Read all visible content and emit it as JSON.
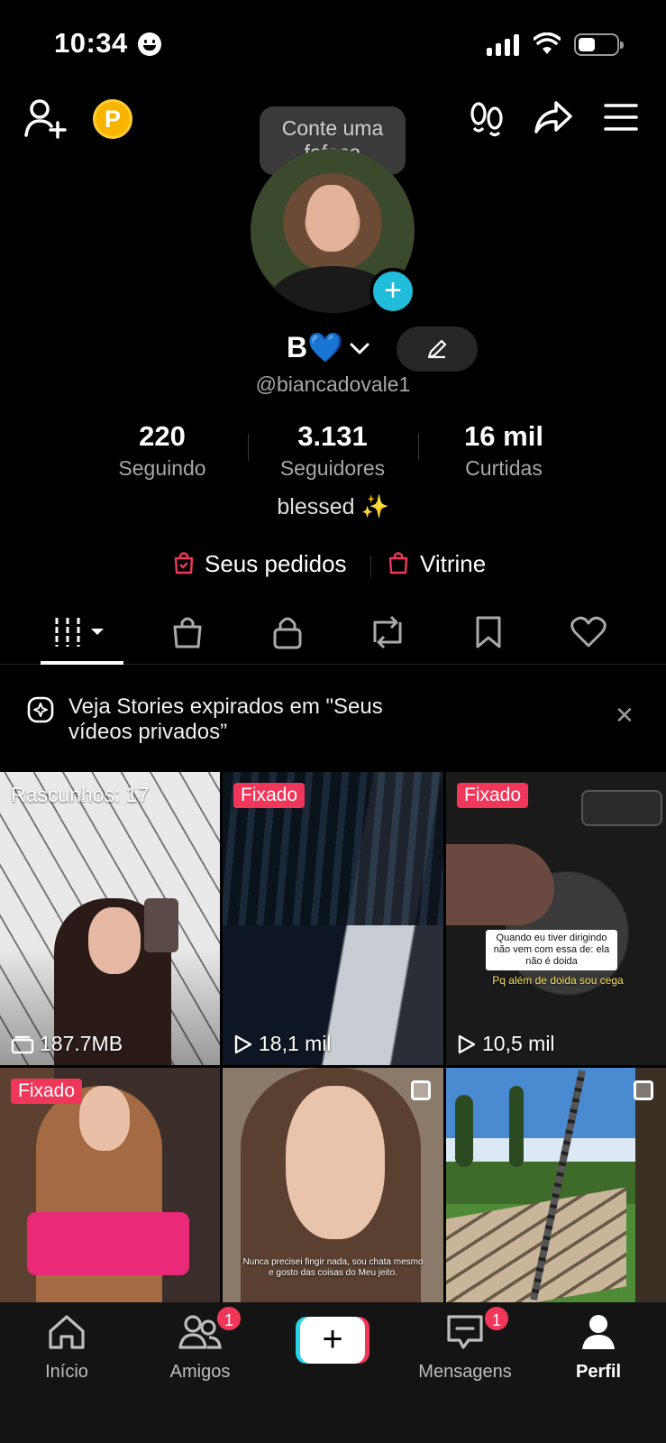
{
  "status_bar": {
    "time": "10:34"
  },
  "tooltip": {
    "text": "Conte uma fofoca"
  },
  "profile": {
    "display_name": "B💙",
    "handle": "@biancadovale1",
    "bio": "blessed ✨"
  },
  "stats": [
    {
      "value": "220",
      "label": "Seguindo"
    },
    {
      "value": "3.131",
      "label": "Seguidores"
    },
    {
      "value": "16 mil",
      "label": "Curtidas"
    }
  ],
  "shop_links": {
    "orders": "Seus pedidos",
    "showcase": "Vitrine"
  },
  "banner": {
    "text": "Veja Stories expirados em \"Seus vídeos privados”",
    "close": "✕"
  },
  "grid": {
    "drafts_label": "Rascunhos: 17",
    "drafts_size": "187.7MB",
    "pinned_label": "Fixado",
    "views": [
      "18,1 mil",
      "10,5 mil"
    ],
    "captions": {
      "tile3": "Quando eu tiver dirigindo não vem com essa de: ela não é doida",
      "tile3_sub": "Pq além de doida sou cega",
      "tile5": "Nunca precisei fingir nada, sou chata mesmo e gosto das coisas do Meu jeito."
    }
  },
  "bottom_nav": {
    "home": "Início",
    "friends": "Amigos",
    "friends_badge": "1",
    "create": "+",
    "messages": "Mensagens",
    "messages_badge": "1",
    "profile": "Perfil"
  },
  "colors": {
    "accent_pink": "#f0375a",
    "accent_cyan": "#20bcd9",
    "background": "#000000"
  }
}
